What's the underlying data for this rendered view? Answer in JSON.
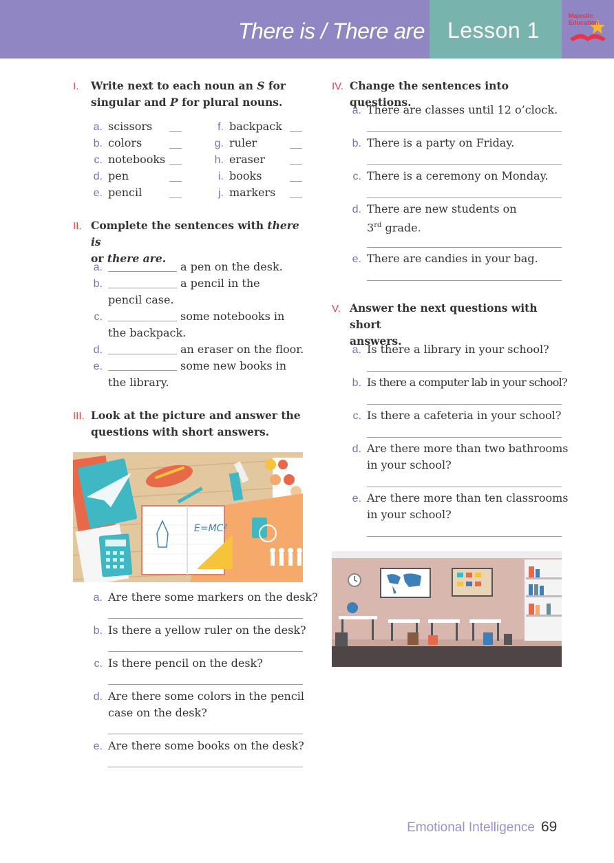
{
  "header": {
    "title": "There is / There are",
    "lesson": "Lesson 1",
    "logo_text": [
      "Majestic",
      "Education"
    ]
  },
  "s1": {
    "num": "I.",
    "heading": [
      "Write next to each noun an ",
      "S",
      " for",
      "singular and ",
      "P",
      " for plural nouns."
    ],
    "left": [
      {
        "letter": "a.",
        "word": "scissors"
      },
      {
        "letter": "b.",
        "word": "colors"
      },
      {
        "letter": "c.",
        "word": "notebooks"
      },
      {
        "letter": "d.",
        "word": "pen"
      },
      {
        "letter": "e.",
        "word": "pencil"
      }
    ],
    "right": [
      {
        "letter": "f.",
        "word": "backpack"
      },
      {
        "letter": "g.",
        "word": "ruler"
      },
      {
        "letter": "h.",
        "word": "eraser"
      },
      {
        "letter": "i.",
        "word": "books"
      },
      {
        "letter": "j.",
        "word": "markers"
      }
    ]
  },
  "s2": {
    "num": "II.",
    "heading": [
      "Complete the sentences with ",
      "there is",
      "or ",
      "there are",
      "."
    ],
    "items": [
      {
        "letter": "a.",
        "l1": "a pen on the desk.",
        "l2": ""
      },
      {
        "letter": "b.",
        "l1": "a pencil in the",
        "l2": "pencil case."
      },
      {
        "letter": "c.",
        "l1": "some notebooks in",
        "l2": "the backpack."
      },
      {
        "letter": "d.",
        "l1": "an eraser on the floor.",
        "l2": ""
      },
      {
        "letter": "e.",
        "l1": "some new books in",
        "l2": "the library."
      }
    ]
  },
  "s3": {
    "num": "III.",
    "heading": [
      "Look at the picture and answer the",
      "questions with short answers."
    ],
    "picture_formula": "E=MC²",
    "items": [
      {
        "letter": "a.",
        "l1": "Are there some markers on the desk?",
        "l2": ""
      },
      {
        "letter": "b.",
        "l1": "Is there a yellow ruler on the desk?",
        "l2": ""
      },
      {
        "letter": "c.",
        "l1": "Is there pencil on the desk?",
        "l2": ""
      },
      {
        "letter": "d.",
        "l1": "Are there some colors in the pencil",
        "l2": "case on the desk?"
      },
      {
        "letter": "e.",
        "l1": "Are there some books on the desk?",
        "l2": ""
      }
    ]
  },
  "s4": {
    "num": "IV.",
    "heading": "Change the sentences into questions.",
    "items": [
      {
        "letter": "a.",
        "l1": "There are classes until 12 o’clock.",
        "l2": ""
      },
      {
        "letter": "b.",
        "l1": "There is a party on Friday.",
        "l2": ""
      },
      {
        "letter": "c.",
        "l1": "There is a ceremony on Monday.",
        "l2": ""
      },
      {
        "letter": "d.",
        "l1": "There are new students on",
        "l2a": "3",
        "l2sup": "rd",
        "l2b": " grade."
      },
      {
        "letter": "e.",
        "l1": "There are candies in your bag.",
        "l2": ""
      }
    ]
  },
  "s5": {
    "num": "V.",
    "heading": [
      "Answer the next questions with short",
      "answers."
    ],
    "items": [
      {
        "letter": "a.",
        "l1": "Is there a library in your school?",
        "l2": ""
      },
      {
        "letter": "b.",
        "l1": "Is there a computer lab in your school?",
        "l2": ""
      },
      {
        "letter": "c.",
        "l1": "Is there a cafeteria in your school?",
        "l2": ""
      },
      {
        "letter": "d.",
        "l1": "Are there more than two bathrooms",
        "l2": "in your school?"
      },
      {
        "letter": "e.",
        "l1": "Are there more than ten classrooms",
        "l2": "in your school?"
      }
    ]
  },
  "footer": {
    "subject": "Emotional Intelligence",
    "page": "69"
  },
  "colors": {
    "header_bg": "#8f86c3",
    "lesson_bg": "#78b3ad",
    "section_num": "#e0443c",
    "item_letter": "#7a70b8"
  }
}
